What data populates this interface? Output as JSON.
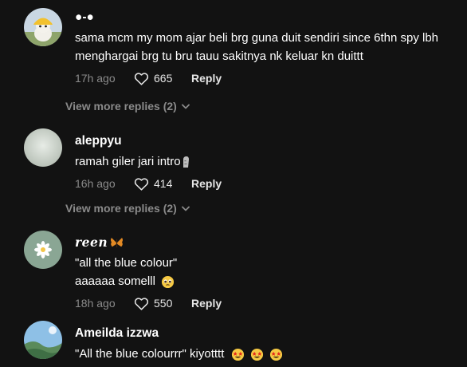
{
  "comments": [
    {
      "username": "●-●",
      "text_lines": [
        "sama mcm my mom ajar beli brg guna duit sendiri since 6thn spy lbh",
        "menghargai brg tu bru tauu sakitnya nk keluar kn duittt"
      ],
      "time": "17h ago",
      "likes": "665",
      "reply_label": "Reply",
      "view_more": "View more replies (2)"
    },
    {
      "username": "aleppyu",
      "text_lines": [
        "ramah giler jari intro"
      ],
      "time": "16h ago",
      "likes": "414",
      "reply_label": "Reply",
      "view_more": "View more replies (2)"
    },
    {
      "username": "reen",
      "text_lines": [
        "\"all the blue colour\"",
        "aaaaaa somelll"
      ],
      "time": "18h ago",
      "likes": "550",
      "reply_label": "Reply"
    },
    {
      "username": "Ameilda izzwa",
      "text_lines": [
        "\"All the blue colourrr\" kiyotttt"
      ]
    }
  ],
  "icons": {
    "like": "heart-outline-icon",
    "expand": "chevron-down-icon",
    "finger_emoji": "moai-icon",
    "pleading_emoji": "pleading-face-icon",
    "star_struck_emoji": "star-struck-icon",
    "butterfly_emoji": "butterfly-icon"
  },
  "colors": {
    "background": "#121212",
    "secondary_text": "#8a8a8a",
    "primary_text": "#ffffff"
  }
}
